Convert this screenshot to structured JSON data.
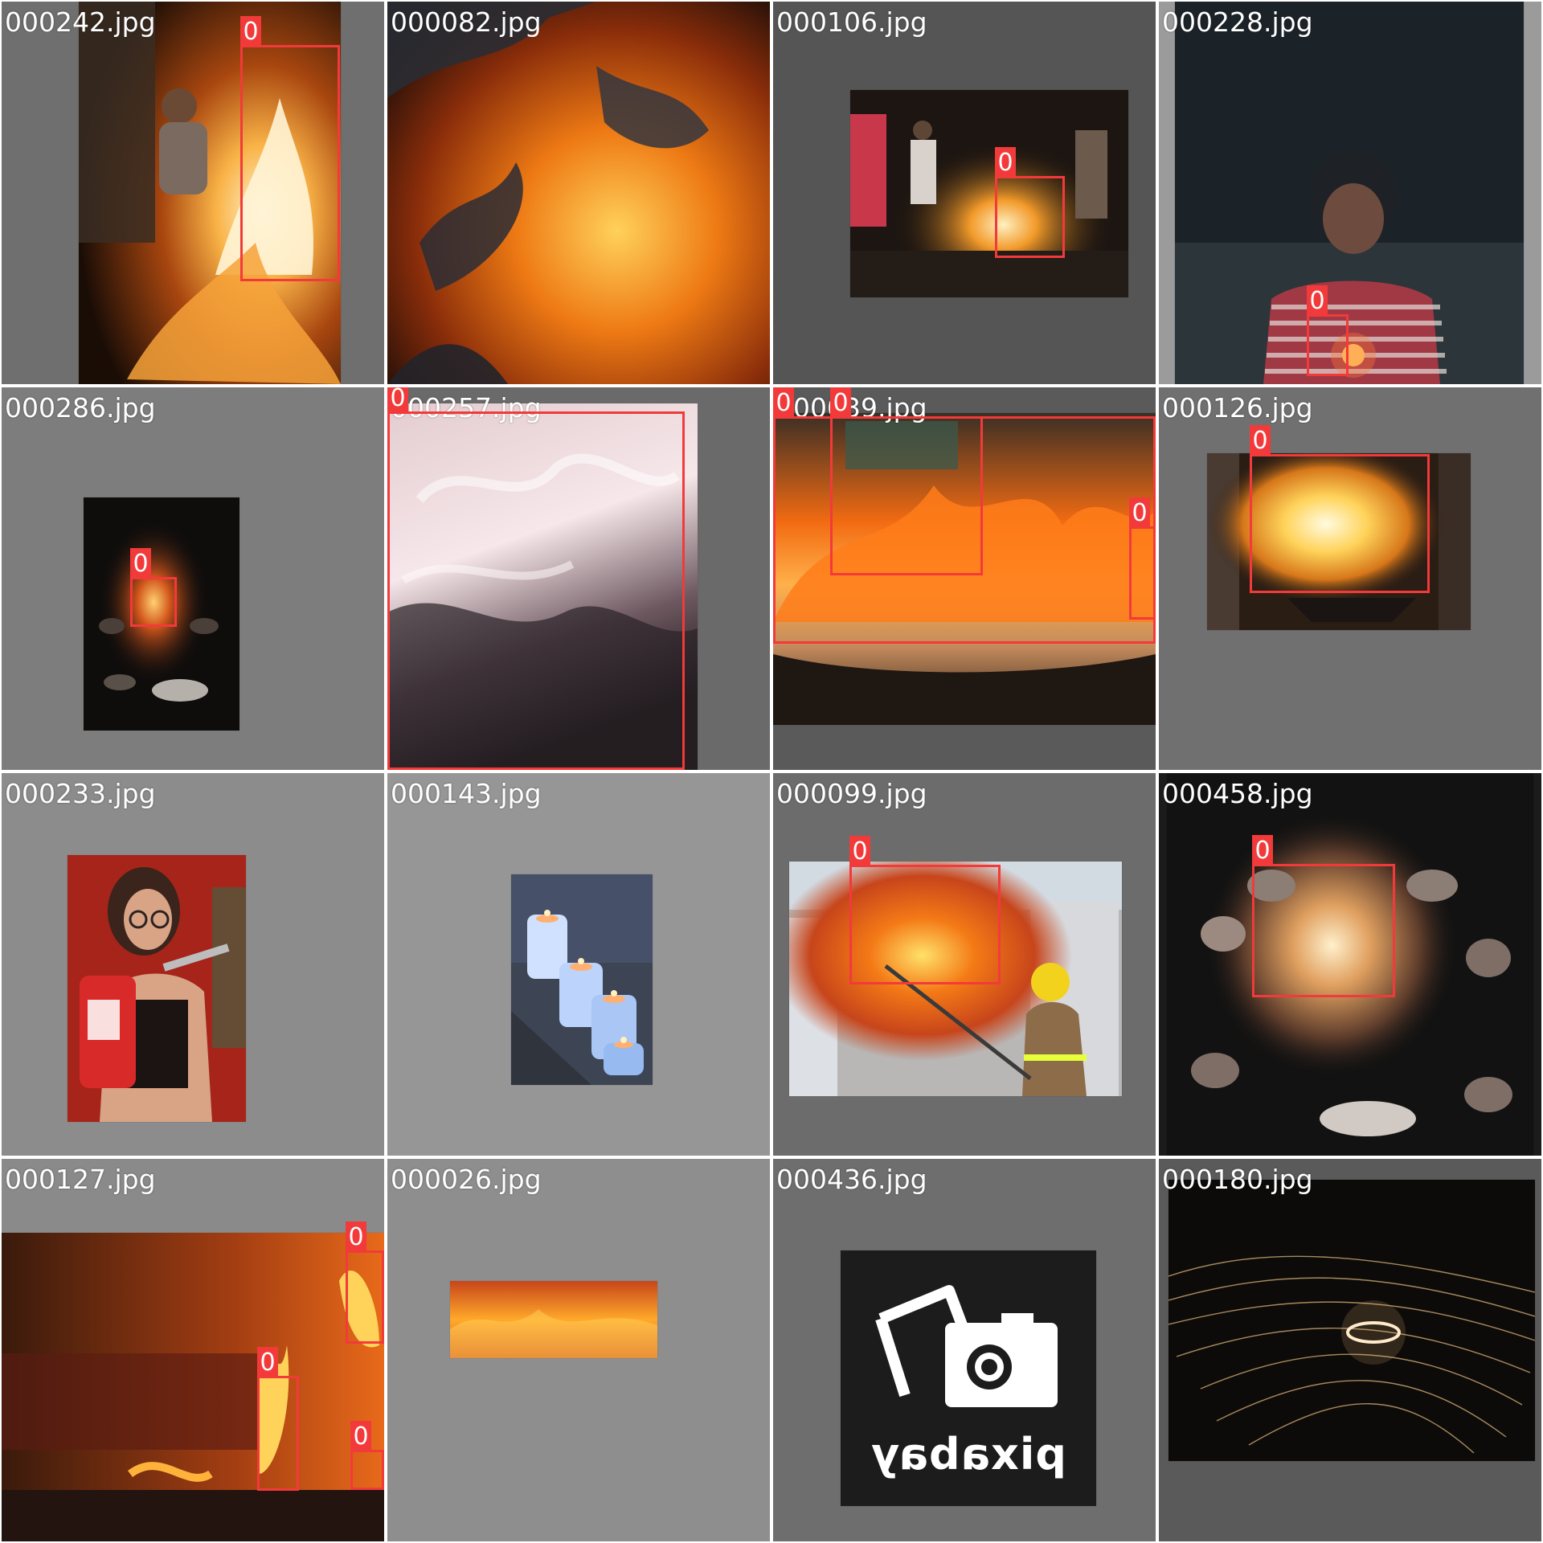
{
  "colors": {
    "box": "#f23a3a",
    "filename_text": "#ffffff"
  },
  "tiles": [
    {
      "filename": "000242.jpg",
      "bg": "#6f6f6f",
      "scene": "campfire-woman",
      "boxes": [
        {
          "label": "0"
        }
      ]
    },
    {
      "filename": "000082.jpg",
      "bg": "#3a2a20",
      "scene": "embers-closeup",
      "boxes": []
    },
    {
      "filename": "000106.jpg",
      "bg": "#555555",
      "scene": "street-fire-night",
      "boxes": [
        {
          "label": "0"
        }
      ]
    },
    {
      "filename": "000228.jpg",
      "bg": "#9b9b9b",
      "scene": "man-holding-flame",
      "boxes": [
        {
          "label": "0"
        }
      ]
    },
    {
      "filename": "000286.jpg",
      "bg": "#7d7d7d",
      "scene": "small-campfire",
      "boxes": [
        {
          "label": "0"
        }
      ]
    },
    {
      "filename": "000257.jpg",
      "bg": "#6a6a6a",
      "scene": "white-flames",
      "boxes": [
        {
          "label": "0"
        }
      ]
    },
    {
      "filename": "000039.jpg",
      "bg": "#5a5a5a",
      "scene": "fire-training-pit",
      "boxes": [
        {
          "label": "0"
        },
        {
          "label": "0"
        },
        {
          "label": "0"
        }
      ]
    },
    {
      "filename": "000126.jpg",
      "bg": "#707070",
      "scene": "brazier-fire",
      "boxes": [
        {
          "label": "0"
        }
      ]
    },
    {
      "filename": "000233.jpg",
      "bg": "#8c8c8c",
      "scene": "woman-extinguisher",
      "boxes": []
    },
    {
      "filename": "000143.jpg",
      "bg": "#969696",
      "scene": "candles",
      "boxes": []
    },
    {
      "filename": "000099.jpg",
      "bg": "#6c6c6c",
      "scene": "firefighter",
      "boxes": [
        {
          "label": "0"
        }
      ]
    },
    {
      "filename": "000458.jpg",
      "bg": "#1b1b1b",
      "scene": "stone-firepit",
      "boxes": [
        {
          "label": "0"
        }
      ]
    },
    {
      "filename": "000127.jpg",
      "bg": "#8a8a8a",
      "scene": "city-street-fires",
      "boxes": [
        {
          "label": "0"
        },
        {
          "label": "0"
        },
        {
          "label": "0"
        }
      ]
    },
    {
      "filename": "000026.jpg",
      "bg": "#8e8e8e",
      "scene": "flame-strip",
      "boxes": []
    },
    {
      "filename": "000436.jpg",
      "bg": "#6e6e6e",
      "scene": "placeholder-camera",
      "boxes": [],
      "logo_text": "pixabay"
    },
    {
      "filename": "000180.jpg",
      "bg": "#5a5a5a",
      "scene": "steel-wool-sparks",
      "boxes": []
    }
  ]
}
